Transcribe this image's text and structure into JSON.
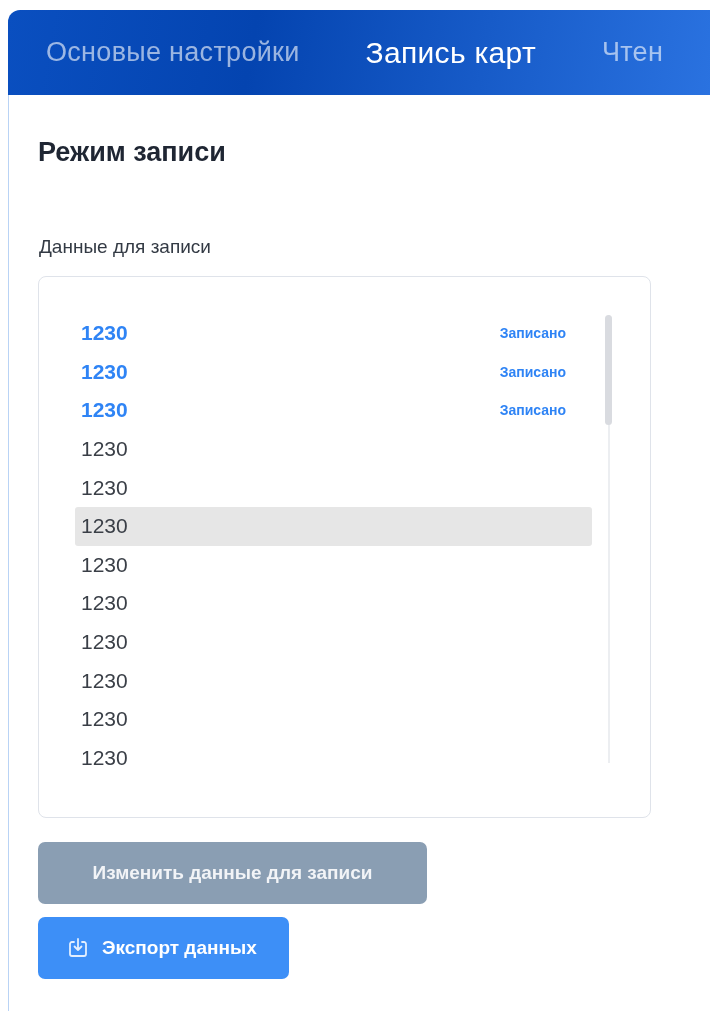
{
  "tabs": [
    {
      "label": "Основые настройки",
      "selected": false
    },
    {
      "label": "Запись карт",
      "selected": true
    },
    {
      "label": "Чтен",
      "selected": false
    }
  ],
  "section_title": "Режим записи",
  "data_label": "Данные для записи",
  "records": [
    {
      "value": "1230",
      "written": true,
      "status": "Записано",
      "selected": false
    },
    {
      "value": "1230",
      "written": true,
      "status": "Записано",
      "selected": false
    },
    {
      "value": "1230",
      "written": true,
      "status": "Записано",
      "selected": false
    },
    {
      "value": "1230",
      "written": false,
      "selected": false
    },
    {
      "value": "1230",
      "written": false,
      "selected": false
    },
    {
      "value": "1230",
      "written": false,
      "selected": true
    },
    {
      "value": "1230",
      "written": false,
      "selected": false
    },
    {
      "value": "1230",
      "written": false,
      "selected": false
    },
    {
      "value": "1230",
      "written": false,
      "selected": false
    },
    {
      "value": "1230",
      "written": false,
      "selected": false
    },
    {
      "value": "1230",
      "written": false,
      "selected": false
    },
    {
      "value": "1230",
      "written": false,
      "selected": false
    }
  ],
  "buttons": [
    {
      "label": "Изменить данные для записи",
      "kind": "plain",
      "disabled": true
    },
    {
      "label": "Экспорт данных",
      "kind": "export",
      "disabled": false
    }
  ]
}
